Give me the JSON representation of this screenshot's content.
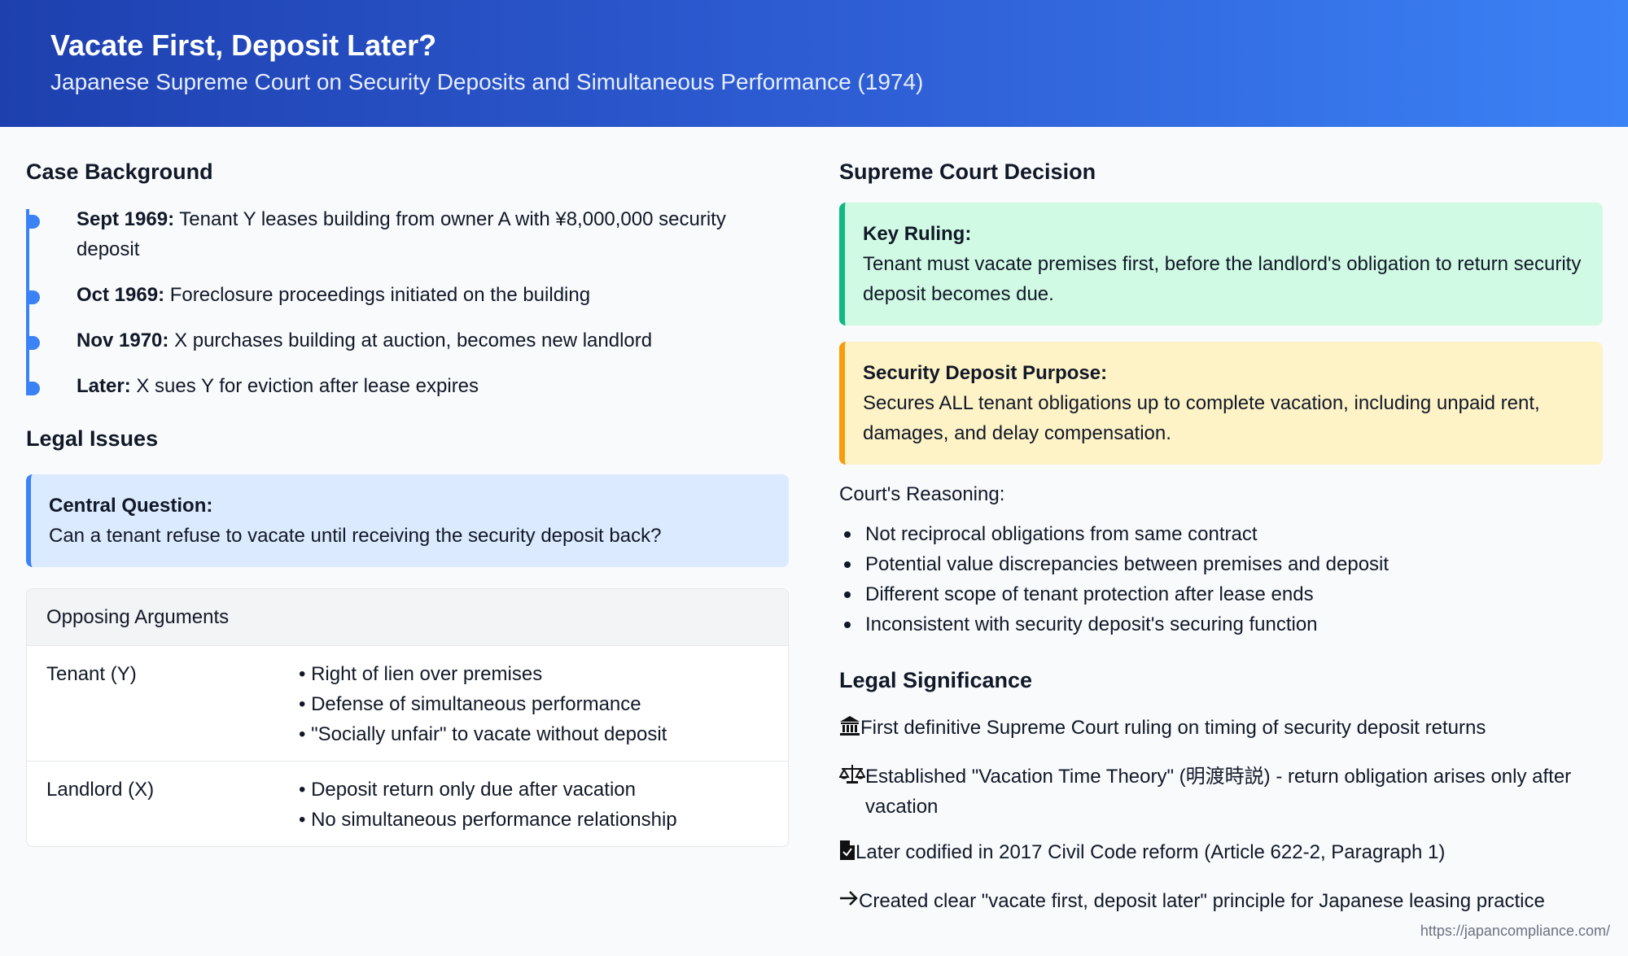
{
  "header": {
    "title": "Vacate First, Deposit Later?",
    "subtitle": "Japanese Supreme Court on Security Deposits and Simultaneous Performance (1974)"
  },
  "background": {
    "heading": "Case Background",
    "timeline": [
      {
        "date": "Sept 1969:",
        "text": "Tenant Y leases building from owner A with ¥8,000,000 security deposit"
      },
      {
        "date": "Oct 1969:",
        "text": "Foreclosure proceedings initiated on the building"
      },
      {
        "date": "Nov 1970:",
        "text": "X purchases building at auction, becomes new landlord"
      },
      {
        "date": "Later:",
        "text": "X sues Y for eviction after lease expires"
      }
    ]
  },
  "issues": {
    "heading": "Legal Issues",
    "central_title": "Central Question:",
    "central_text": "Can a tenant refuse to vacate until receiving the security deposit back?",
    "arguments_heading": "Opposing Arguments",
    "tenant": {
      "party": "Tenant (Y)",
      "points": [
        "• Right of lien over premises",
        "• Defense of simultaneous performance",
        "• \"Socially unfair\" to vacate without deposit"
      ]
    },
    "landlord": {
      "party": "Landlord (X)",
      "points": [
        "• Deposit return only due after vacation",
        "• No simultaneous performance relationship"
      ]
    }
  },
  "decision": {
    "heading": "Supreme Court Decision",
    "key_title": "Key Ruling:",
    "key_text": "Tenant must vacate premises first, before the landlord's obligation to return security deposit becomes due.",
    "purpose_title": "Security Deposit Purpose:",
    "purpose_text": "Secures ALL tenant obligations up to complete vacation, including unpaid rent, damages, and delay compensation.",
    "reasoning_title": "Court's Reasoning:",
    "reasons": [
      "Not reciprocal obligations from same contract",
      "Potential value discrepancies between premises and deposit",
      "Different scope of tenant protection after lease ends",
      "Inconsistent with security deposit's securing function"
    ]
  },
  "significance": {
    "heading": "Legal Significance",
    "items": [
      {
        "icon": "bank-icon",
        "text": "First definitive Supreme Court ruling on timing of security deposit returns"
      },
      {
        "icon": "scales-icon",
        "text": "Established \"Vacation Time Theory\" (明渡時説) - return obligation arises only after vacation"
      },
      {
        "icon": "document-icon",
        "text": "Later codified in 2017 Civil Code reform (Article 622-2, Paragraph 1)"
      },
      {
        "icon": "arrow-right-icon",
        "text": "Created clear \"vacate first, deposit later\" principle for Japanese leasing practice"
      }
    ]
  },
  "footer": {
    "url": "https://japancompliance.com/"
  }
}
